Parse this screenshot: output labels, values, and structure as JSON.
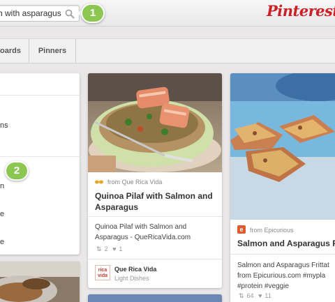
{
  "header": {
    "search": {
      "value": "h with asparagus",
      "icon": "magnifier-icon"
    },
    "logo": "Pinterest",
    "callouts": [
      "1",
      "2"
    ]
  },
  "tabs": [
    {
      "label": "oards"
    },
    {
      "label": "Pinners"
    }
  ],
  "left_card": {
    "items": [
      "ns",
      "n",
      "e",
      "e"
    ]
  },
  "pins": [
    {
      "source_prefix": "from",
      "source": "Que Rica Vida",
      "title": "Quinoa Pilaf with Salmon and Asparagus",
      "description": "Quinoa Pilaf with Salmon and Asparagus - QueRicaVida.com",
      "repins": "2",
      "likes": "1",
      "pinner": "Que Rica Vida",
      "board": "Light Dishes",
      "avatar_text": "rica vida"
    },
    {
      "source_prefix": "from",
      "source": "Epicurious",
      "title": "Salmon and Asparagus Fr",
      "description": "Salmon and Asparagus Frittat from Epicurious.com #mypla #protein #veggie",
      "repins": "64",
      "likes": "11",
      "source_icon_text": "e"
    }
  ],
  "colors": {
    "brand": "#cb2027",
    "callout": "#8cc752",
    "source_icon": "#e35a2c"
  }
}
